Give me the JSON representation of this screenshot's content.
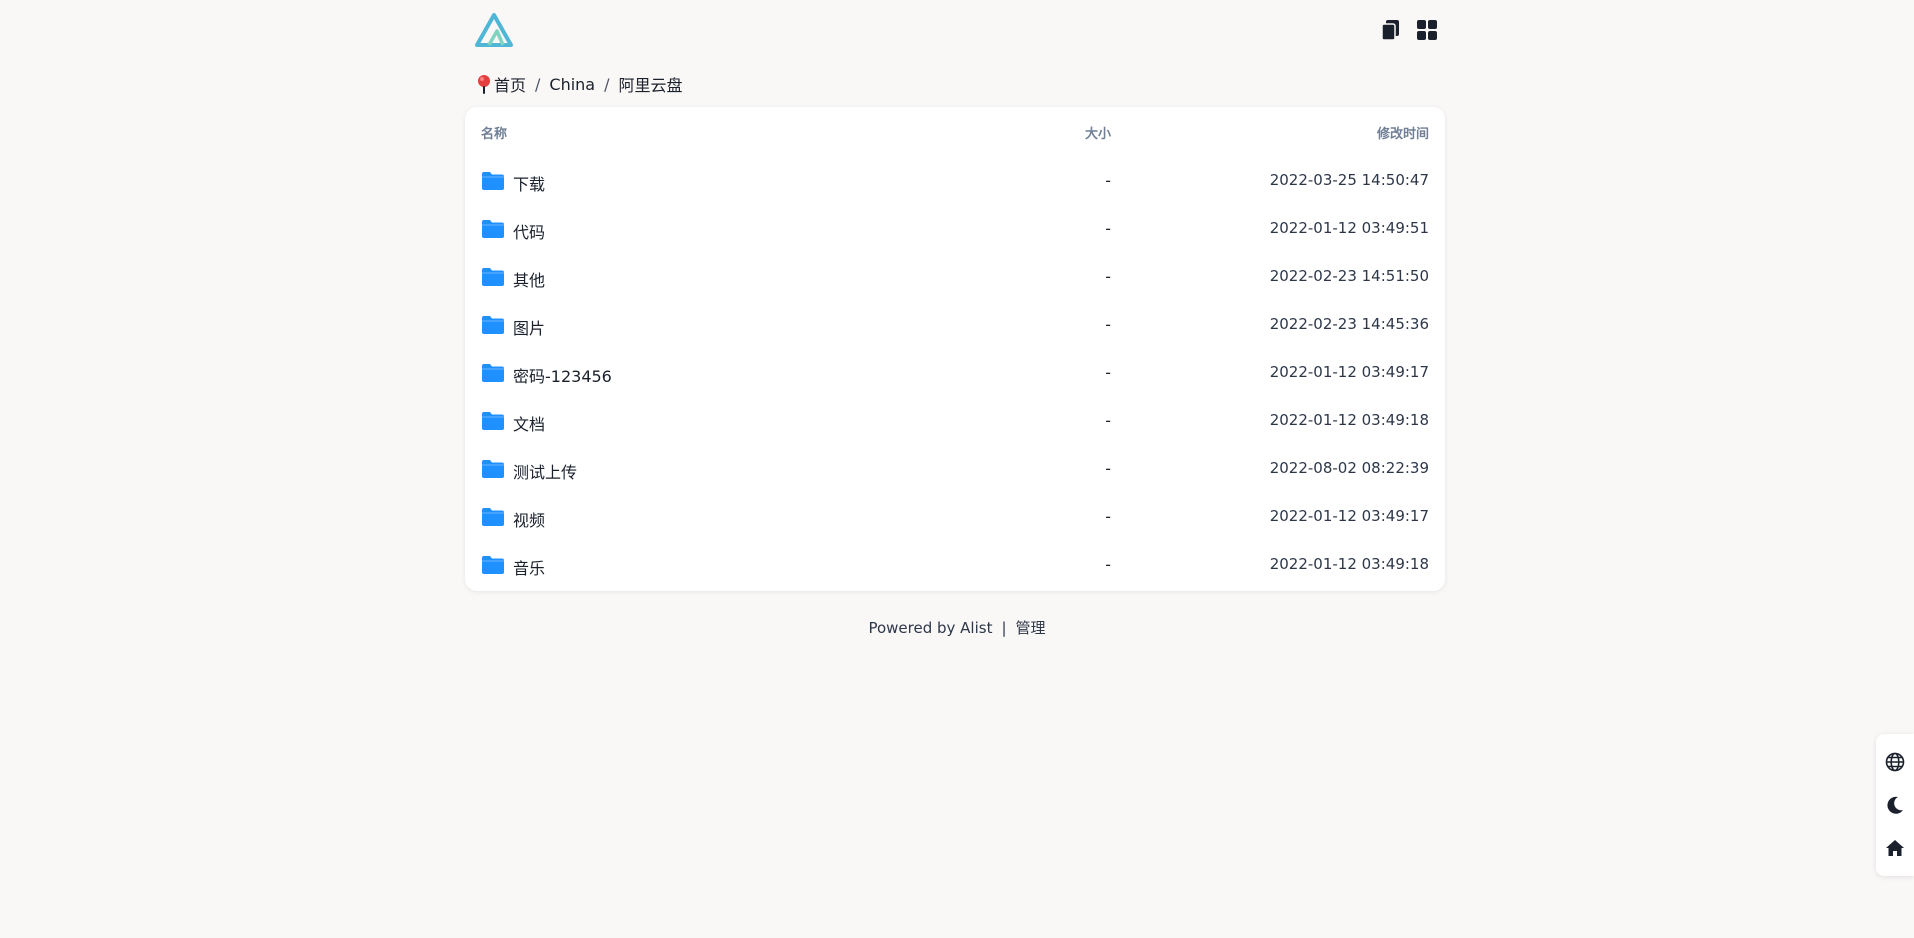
{
  "header": {
    "logo_icon": "alist-logo-icon",
    "actions": [
      {
        "name": "list-view-icon"
      },
      {
        "name": "grid-view-icon"
      }
    ]
  },
  "breadcrumb": {
    "icon": "location-pin-icon",
    "items": [
      "首页",
      "China",
      "阿里云盘"
    ],
    "separator": "/"
  },
  "table": {
    "columns": {
      "name": "名称",
      "size": "大小",
      "modified": "修改时间"
    },
    "rows": [
      {
        "name": "下载",
        "size": "-",
        "modified": "2022-03-25 14:50:47",
        "icon": "folder-icon"
      },
      {
        "name": "代码",
        "size": "-",
        "modified": "2022-01-12 03:49:51",
        "icon": "folder-icon"
      },
      {
        "name": "其他",
        "size": "-",
        "modified": "2022-02-23 14:51:50",
        "icon": "folder-icon"
      },
      {
        "name": "图片",
        "size": "-",
        "modified": "2022-02-23 14:45:36",
        "icon": "folder-icon"
      },
      {
        "name": "密码-123456",
        "size": "-",
        "modified": "2022-01-12 03:49:17",
        "icon": "folder-icon"
      },
      {
        "name": "文档",
        "size": "-",
        "modified": "2022-01-12 03:49:18",
        "icon": "folder-icon"
      },
      {
        "name": "测试上传",
        "size": "-",
        "modified": "2022-08-02 08:22:39",
        "icon": "folder-icon"
      },
      {
        "name": "视频",
        "size": "-",
        "modified": "2022-01-12 03:49:17",
        "icon": "folder-icon"
      },
      {
        "name": "音乐",
        "size": "-",
        "modified": "2022-01-12 03:49:18",
        "icon": "folder-icon"
      }
    ]
  },
  "footer": {
    "powered": "Powered by Alist",
    "separator": "|",
    "admin": "管理"
  },
  "sidebar": {
    "buttons": [
      {
        "name": "language-globe-icon"
      },
      {
        "name": "dark-mode-moon-icon"
      },
      {
        "name": "home-icon"
      }
    ]
  },
  "colors": {
    "background": "#faf8f7",
    "folder": "#1e90ff",
    "logo_primary": "#4fb6d6",
    "logo_secondary": "#7fd4c1"
  }
}
